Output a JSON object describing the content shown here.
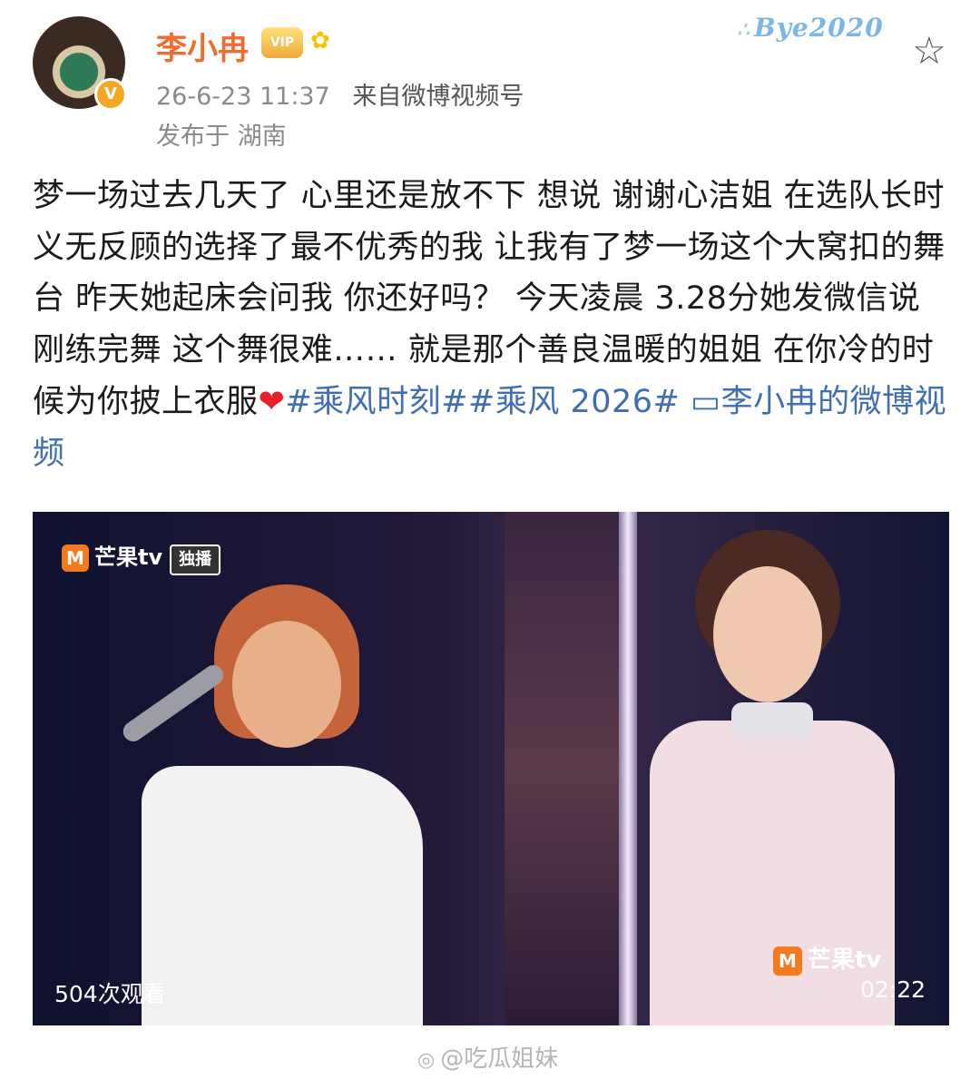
{
  "user": {
    "name": "李小冉",
    "vip_badge": "VIP",
    "verified_badge": "V",
    "post_time": "26-6-23 11:37",
    "source_prefix": "来自",
    "source": "微博视频号",
    "location": "发布于 湖南"
  },
  "top_right": {
    "decoration_text": "Bye2020"
  },
  "post": {
    "body": "梦一场过去几天了 心里还是放不下 想说 谢谢心洁姐 在选队长时 义无反顾的选择了最不优秀的我 让我有了梦一场这个大窝扣的舞台 昨天她起床会问我 你还好吗？ 今天凌晨 3.28分她发微信说刚练完舞 这个舞很难…… 就是那个善良温暖的姐姐 在你冷的时候为你披上衣服",
    "heart": "❤",
    "tag1": "#乘风时刻#",
    "tag2": "#乘风 2026#",
    "video_link_icon": "▭",
    "video_link": "李小冉的微博视频"
  },
  "video": {
    "logo_top_text": "芒果tv",
    "logo_top_badge": "独播",
    "logo_bottom_text": "芒果tv",
    "logo_m": "M",
    "views": "504次观看",
    "duration": "02:22"
  },
  "watermark": {
    "icon": "◎",
    "text": "@吃瓜姐妹"
  }
}
